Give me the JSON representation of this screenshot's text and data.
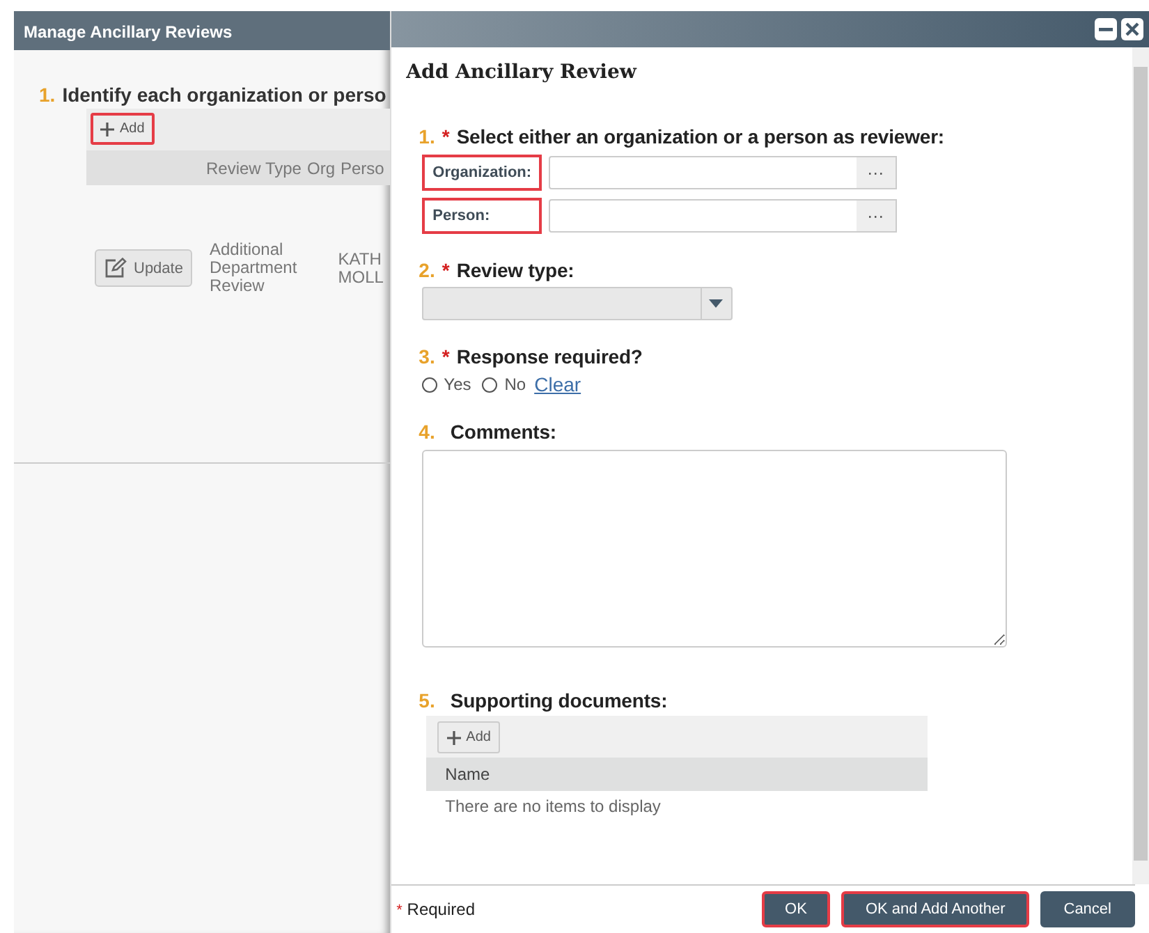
{
  "background_window": {
    "title": "Manage Ancillary Reviews",
    "step_number": "1.",
    "step_label": "Identify each organization or perso",
    "add_button": {
      "label": "Add",
      "highlighted": true
    },
    "table": {
      "columns": [
        "Review Type",
        "Org",
        "Perso"
      ],
      "rows": [
        {
          "action": "Update",
          "cells": [
            "Additional Department Review",
            "",
            "KATH MOLL"
          ]
        }
      ]
    }
  },
  "dialog": {
    "title": "Add Ancillary Review",
    "questions": [
      {
        "kind": "reviewer",
        "number": "1.",
        "required": true,
        "label": "Select either an organization or a person as reviewer:",
        "fields": [
          {
            "label": "Organization:",
            "highlighted": true,
            "lookup": "···"
          },
          {
            "label": "Person:",
            "highlighted": true,
            "lookup": "···"
          }
        ]
      },
      {
        "kind": "select",
        "number": "2.",
        "required": true,
        "label": "Review type:"
      },
      {
        "kind": "radio",
        "number": "3.",
        "required": true,
        "label": "Response required?",
        "options": [
          {
            "label": "Yes",
            "selected": false
          },
          {
            "label": "No",
            "selected": false
          }
        ],
        "clear_link": "Clear"
      },
      {
        "kind": "textarea",
        "number": "4.",
        "required": false,
        "label": "Comments:"
      },
      {
        "kind": "documents",
        "number": "5.",
        "required": false,
        "label": "Supporting documents:",
        "add_button": "Add",
        "column": "Name",
        "empty_text": "There are no items to display"
      }
    ],
    "footer": {
      "required_mark": "*",
      "required_text": "Required",
      "buttons": [
        {
          "label": "OK",
          "highlighted": true
        },
        {
          "label": "OK and Add Another",
          "highlighted": true
        },
        {
          "label": "Cancel",
          "highlighted": false
        }
      ]
    }
  }
}
